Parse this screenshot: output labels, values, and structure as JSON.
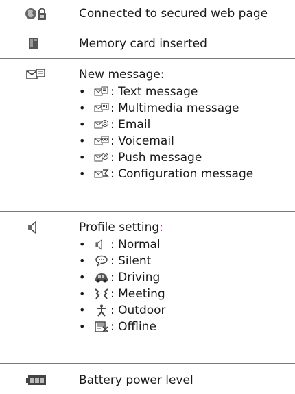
{
  "rows": {
    "secure": {
      "icon": "secure-connection-icon",
      "label": "Connected to secured web page"
    },
    "memory": {
      "icon": "memory-card-icon",
      "label": "Memory card inserted"
    },
    "message": {
      "icon": "envelope-icon",
      "label": "New message:",
      "items": [
        {
          "icon": "text-message-icon",
          "label": ": Text message"
        },
        {
          "icon": "multimedia-message-icon",
          "label": ": Multimedia message"
        },
        {
          "icon": "email-icon",
          "label": ": Email"
        },
        {
          "icon": "voicemail-icon",
          "label": ": Voicemail"
        },
        {
          "icon": "push-message-icon",
          "label": ": Push message"
        },
        {
          "icon": "configuration-message-icon",
          "label": ": Configuration message"
        }
      ]
    },
    "profile": {
      "icon": "speaker-icon",
      "label": "Profile setting",
      "label_colon": ":",
      "label_colon_color": "#c0398f",
      "items": [
        {
          "icon": "speaker-icon",
          "label": ": Normal"
        },
        {
          "icon": "speech-bubble-icon",
          "label": ": Silent"
        },
        {
          "icon": "car-icon",
          "label": ": Driving"
        },
        {
          "icon": "meeting-icon",
          "label": ": Meeting"
        },
        {
          "icon": "person-running-icon",
          "label": ": Outdoor"
        },
        {
          "icon": "offline-icon",
          "label": ": Offline"
        }
      ]
    },
    "battery": {
      "icon": "battery-icon",
      "label": "Battery power level"
    }
  },
  "bullet": "•"
}
